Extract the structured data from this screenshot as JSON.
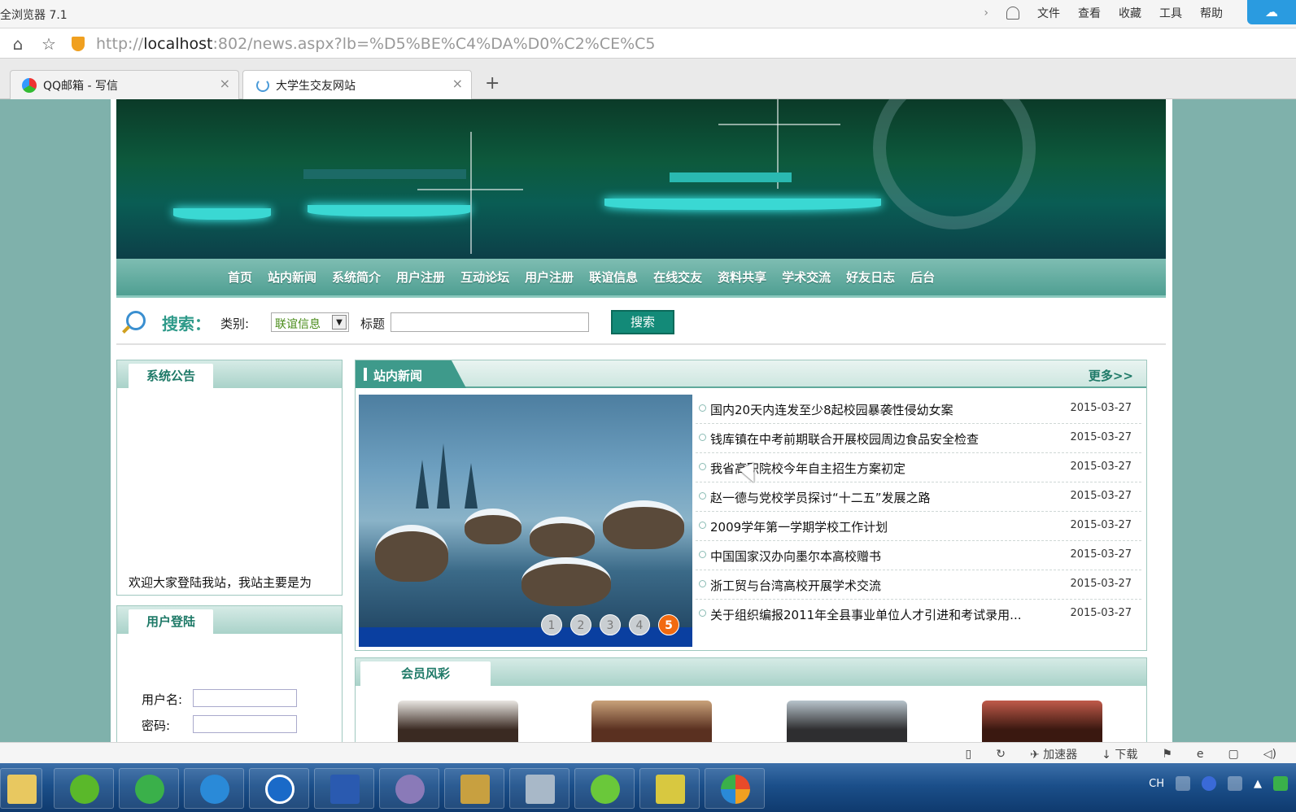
{
  "browser": {
    "app_title": "全浏览器 7.1",
    "menu": [
      "文件",
      "查看",
      "收藏",
      "工具",
      "帮助"
    ],
    "url_prefix": "http://",
    "url_host": "localhost",
    "url_rest": ":802/news.aspx?lb=%D5%BE%C4%DA%D0%C2%CE%C5",
    "tabs": [
      {
        "label": "QQ邮箱 - 写信"
      },
      {
        "label": "大学生交友网站"
      }
    ],
    "new_tab": "+",
    "status_items": [
      "加速器",
      "下载"
    ]
  },
  "site": {
    "nav": [
      "首页",
      "站内新闻",
      "系统简介",
      "用户注册",
      "互动论坛",
      "用户注册",
      "联谊信息",
      "在线交友",
      "资料共享",
      "学术交流",
      "好友日志",
      "后台"
    ],
    "search": {
      "title": "搜索：",
      "category_label": "类别:",
      "category_value": "联谊信息",
      "title_label": "标题",
      "button": "搜索"
    },
    "notice": {
      "heading": "系统公告",
      "text": "欢迎大家登陆我站，我站主要是为"
    },
    "login": {
      "heading": "用户登陆",
      "username_label": "用户名:",
      "password_label": "密码:"
    },
    "news": {
      "heading": "站内新闻",
      "more": "更多>>",
      "slide_pages": [
        "1",
        "2",
        "3",
        "4",
        "5"
      ],
      "active_page": "5",
      "items": [
        {
          "title": "国内20天内连发至少8起校园暴袭性侵幼女案",
          "date": "2015-03-27"
        },
        {
          "title": "钱库镇在中考前期联合开展校园周边食品安全检查",
          "date": "2015-03-27"
        },
        {
          "title": "我省高职院校今年自主招生方案初定",
          "date": "2015-03-27"
        },
        {
          "title": "赵一德与党校学员探讨“十二五”发展之路",
          "date": "2015-03-27"
        },
        {
          "title": "2009学年第一学期学校工作计划",
          "date": "2015-03-27"
        },
        {
          "title": "中国国家汉办向墨尔本高校赠书",
          "date": "2015-03-27"
        },
        {
          "title": "浙工贸与台湾高校开展学术交流",
          "date": "2015-03-27"
        },
        {
          "title": "关于组织编报2011年全县事业单位人才引进和考试录用...",
          "date": "2015-03-27"
        }
      ]
    },
    "members": {
      "heading": "会员风彩"
    }
  },
  "taskbar": {
    "tray_lang": "CH"
  },
  "colors": {
    "page_bg": "#7fb1ab",
    "accent": "#138a78",
    "active_dot": "#f26a10"
  }
}
